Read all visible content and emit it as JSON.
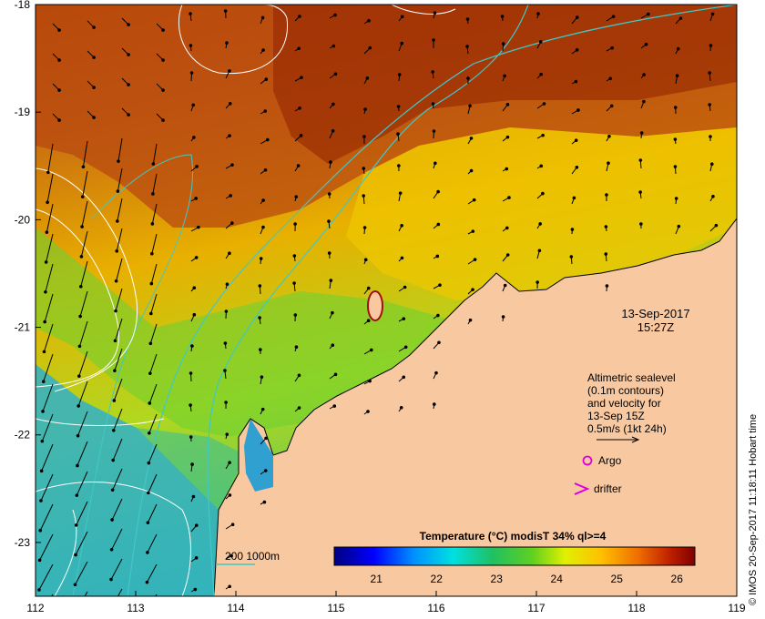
{
  "map": {
    "lon_ticks": [
      "112",
      "113",
      "114",
      "115",
      "116",
      "117",
      "118",
      "119"
    ],
    "lat_ticks": [
      "-18",
      "-19",
      "-20",
      "-21",
      "-22",
      "-23"
    ],
    "lon_range": [
      112,
      119
    ],
    "lat_range": [
      -23.5,
      -18
    ]
  },
  "timestamp": {
    "date": "13-Sep-2017",
    "time": "15:27Z"
  },
  "altimetry_note": {
    "line1": "Altimetric sealevel",
    "line2": "(0.1m contours)",
    "line3": "and velocity for",
    "line4": "13-Sep 15Z",
    "line5": "0.5m/s (1kt 24h)"
  },
  "legend": {
    "argo_label": "Argo",
    "drifter_label": "drifter",
    "isobath_label": "200  1000m",
    "argo_color": "#dd00dd",
    "drifter_color": "#dd00dd",
    "isobath_color": "#40c8c8"
  },
  "colorbar": {
    "title": "Temperature (°C) modisT 34% ql>=4",
    "ticks": [
      "21",
      "22",
      "23",
      "24",
      "25",
      "26"
    ],
    "range": [
      20.3,
      26.3
    ]
  },
  "credit": "© IMOS 20-Sep-2017 11:18:11 Hobart time",
  "colors": {
    "land": "#f8c8a0",
    "sst_warm": "#a02800",
    "sst_mid": "#f0d000",
    "sst_cool": "#30b0d0"
  }
}
